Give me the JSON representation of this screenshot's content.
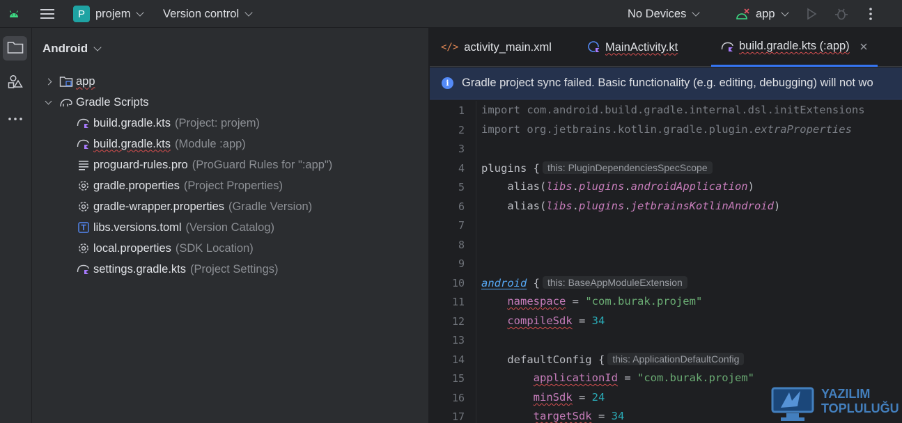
{
  "topbar": {
    "project_badge": "P",
    "project_name": "projem",
    "vcs_label": "Version control",
    "devices_label": "No Devices",
    "run_config": "app"
  },
  "panel": {
    "title": "Android",
    "tree": [
      {
        "label": "app",
        "hint": ""
      },
      {
        "label": "Gradle Scripts",
        "hint": ""
      },
      {
        "label": "build.gradle.kts",
        "hint": "(Project: projem)"
      },
      {
        "label": "build.gradle.kts",
        "hint": "(Module :app)"
      },
      {
        "label": "proguard-rules.pro",
        "hint": "(ProGuard Rules for \":app\")"
      },
      {
        "label": "gradle.properties",
        "hint": "(Project Properties)"
      },
      {
        "label": "gradle-wrapper.properties",
        "hint": "(Gradle Version)"
      },
      {
        "label": "libs.versions.toml",
        "hint": "(Version Catalog)"
      },
      {
        "label": "local.properties",
        "hint": "(SDK Location)"
      },
      {
        "label": "settings.gradle.kts",
        "hint": "(Project Settings)"
      }
    ]
  },
  "tabs": [
    {
      "label": "activity_main.xml"
    },
    {
      "label": "MainActivity.kt"
    },
    {
      "label": "build.gradle.kts (:app)"
    }
  ],
  "banner": {
    "text": "Gradle project sync failed. Basic functionality (e.g. editing, debugging) will not wo"
  },
  "code": {
    "line_numbers": [
      "1",
      "2",
      "3",
      "4",
      "5",
      "6",
      "7",
      "8",
      "9",
      "10",
      "11",
      "12",
      "13",
      "14",
      "15",
      "16",
      "17"
    ],
    "l1": "import com.android.build.gradle.internal.dsl.initExtensions",
    "l2a": "import org.jetbrains.kotlin.gradle.plugin.",
    "l2b": "extraProperties",
    "l4_kw": "plugins",
    "l4_brace": " {",
    "l4_hint": "this: PluginDependenciesSpecScope",
    "l5": {
      "fn": "    alias(",
      "a": "libs",
      "b": "plugins",
      "c": "androidApplication",
      "end": ")"
    },
    "l6": {
      "fn": "    alias(",
      "a": "libs",
      "b": "plugins",
      "c": "jetbrainsKotlinAndroid",
      "end": ")"
    },
    "l10_kw": "android",
    "l10_brace": " {",
    "l10_hint": "this: BaseAppModuleExtension",
    "l11": {
      "prop": "namespace",
      "eq": " = ",
      "str": "\"com.burak.projem\""
    },
    "l12": {
      "prop": "compileSdk",
      "eq": " = ",
      "num": "34"
    },
    "l14_kw": "    defaultConfig {",
    "l14_hint": "this: ApplicationDefaultConfig",
    "l15": {
      "prop": "applicationId",
      "eq": " = ",
      "str": "\"com.burak.projem\""
    },
    "l16": {
      "prop": "minSdk",
      "eq": " = ",
      "num": "24"
    },
    "l17": {
      "prop": "targetSdk",
      "eq": " = ",
      "num": "34"
    }
  },
  "watermark": {
    "line1": "YAZILIM",
    "line2": "TOPLULUĞU"
  },
  "colors": {
    "accent": "#3574f0",
    "banner_bg": "#25324d",
    "project_badge": "#1fa3a3"
  }
}
